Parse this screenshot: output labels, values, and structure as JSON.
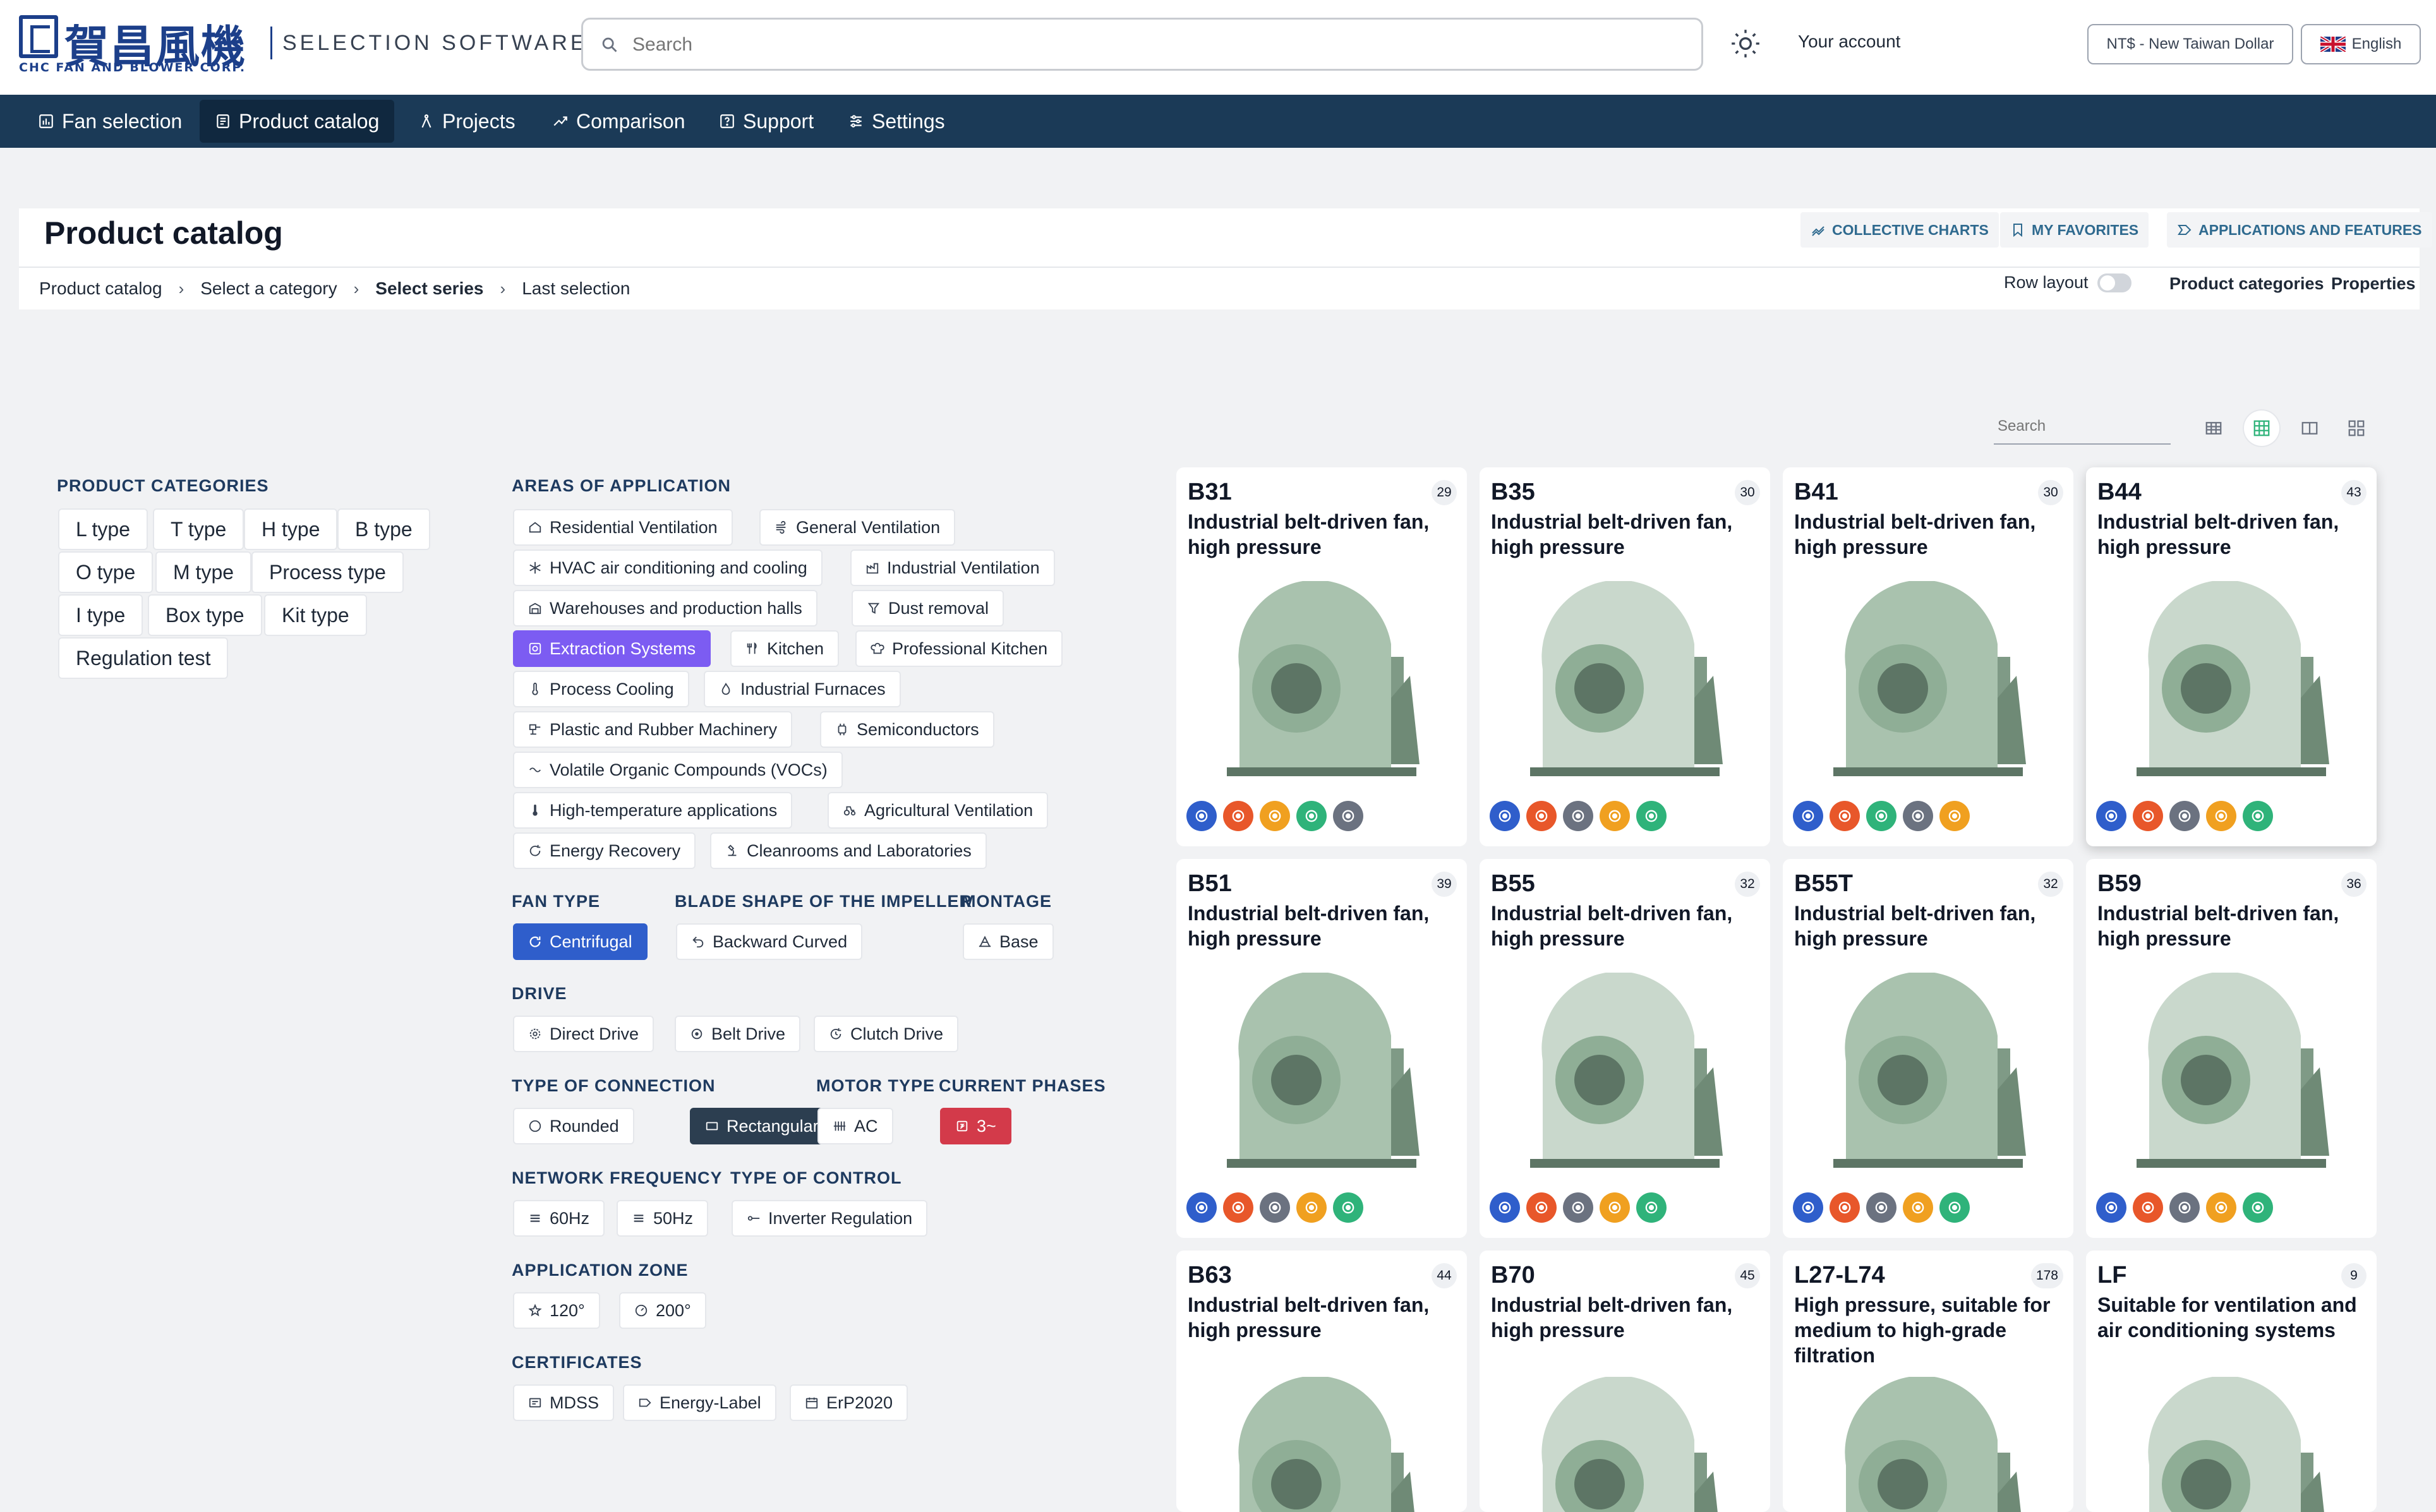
{
  "header": {
    "logo_cn": "賀昌風機",
    "logo_en": "CHC FAN AND BLOWER CORP.",
    "app_title": "SELECTION SOFTWARE",
    "search_placeholder": "Search",
    "account": "Your account",
    "currency": "NT$ - New Taiwan Dollar",
    "language": "English"
  },
  "nav": [
    {
      "label": "Fan selection",
      "icon": "chart-icon"
    },
    {
      "label": "Product catalog",
      "icon": "catalog-icon"
    },
    {
      "label": "Projects",
      "icon": "compass-icon"
    },
    {
      "label": "Comparison",
      "icon": "compare-icon"
    },
    {
      "label": "Support",
      "icon": "help-icon"
    },
    {
      "label": "Settings",
      "icon": "sliders-icon"
    }
  ],
  "page": {
    "title": "Product catalog",
    "actions": [
      "COLLECTIVE CHARTS",
      "MY FAVORITES",
      "APPLICATIONS AND FEATURES"
    ],
    "breadcrumb": [
      "Product catalog",
      "Select a category",
      "Select series",
      "Last selection"
    ],
    "row_layout": "Row layout",
    "links": [
      "Product categories",
      "Properties"
    ]
  },
  "filters": {
    "categories_title": "PRODUCT CATEGORIES",
    "categories": [
      "L type",
      "T type",
      "H type",
      "B type",
      "O type",
      "M type",
      "Process type",
      "I type",
      "Box type",
      "Kit type",
      "Regulation test"
    ],
    "areas_title": "AREAS OF APPLICATION",
    "areas": [
      "Residential Ventilation",
      "General Ventilation",
      "HVAC air conditioning and cooling",
      "Industrial Ventilation",
      "Warehouses and production halls",
      "Dust removal",
      "Extraction Systems",
      "Kitchen",
      "Professional Kitchen",
      "Process Cooling",
      "Industrial Furnaces",
      "Plastic and Rubber Machinery",
      "Semiconductors",
      "Volatile Organic Compounds (VOCs)",
      "High-temperature applications",
      "Agricultural Ventilation",
      "Energy Recovery",
      "Cleanrooms and Laboratories"
    ],
    "fan_type_title": "FAN TYPE",
    "fan_type": [
      "Centrifugal"
    ],
    "blade_title": "BLADE SHAPE OF THE IMPELLER",
    "blade": [
      "Backward Curved"
    ],
    "montage_title": "MONTAGE",
    "montage": [
      "Base"
    ],
    "drive_title": "DRIVE",
    "drive": [
      "Direct Drive",
      "Belt Drive",
      "Clutch Drive"
    ],
    "connection_title": "TYPE OF CONNECTION",
    "connection": [
      "Rounded",
      "Rectangular"
    ],
    "motor_title": "MOTOR TYPE",
    "motor": [
      "AC"
    ],
    "phases_title": "CURRENT PHASES",
    "phases": [
      "3~"
    ],
    "frequency_title": "NETWORK FREQUENCY",
    "frequency": [
      "60Hz",
      "50Hz"
    ],
    "control_title": "TYPE OF CONTROL",
    "control": [
      "Inverter Regulation"
    ],
    "zone_title": "APPLICATION ZONE",
    "zone": [
      "120°",
      "200°"
    ],
    "cert_title": "CERTIFICATES",
    "cert": [
      "MDSS",
      "Energy-Label",
      "ErP2020"
    ]
  },
  "catalog": {
    "search_placeholder": "Search",
    "view_modes": [
      "table-view-icon",
      "grid-view-icon",
      "columns-view-icon",
      "tiles-view-icon"
    ],
    "badge_colors": {
      "blue": "#2f5ecb",
      "orange": "#e8572a",
      "grey": "#6b7280",
      "yellow": "#f0a020",
      "green": "#2fb37a"
    },
    "cards": [
      {
        "code": "B31",
        "count": "29",
        "desc": "Industrial belt-driven fan, high pressure",
        "badges": [
          "blue",
          "orange",
          "yellow",
          "green",
          "grey"
        ]
      },
      {
        "code": "B35",
        "count": "30",
        "desc": "Industrial belt-driven fan, high pressure",
        "badges": [
          "blue",
          "orange",
          "grey",
          "yellow",
          "green"
        ]
      },
      {
        "code": "B41",
        "count": "30",
        "desc": "Industrial belt-driven fan, high pressure",
        "badges": [
          "blue",
          "orange",
          "green",
          "grey",
          "yellow"
        ]
      },
      {
        "code": "B44",
        "count": "43",
        "desc": "Industrial belt-driven fan, high pressure",
        "badges": [
          "blue",
          "orange",
          "grey",
          "yellow",
          "green"
        ]
      },
      {
        "code": "B51",
        "count": "39",
        "desc": "Industrial belt-driven fan, high pressure",
        "badges": [
          "blue",
          "orange",
          "grey",
          "yellow",
          "green"
        ]
      },
      {
        "code": "B55",
        "count": "32",
        "desc": "Industrial belt-driven fan, high pressure",
        "badges": [
          "blue",
          "orange",
          "grey",
          "yellow",
          "green"
        ]
      },
      {
        "code": "B55T",
        "count": "32",
        "desc": "Industrial belt-driven fan, high pressure",
        "badges": [
          "blue",
          "orange",
          "grey",
          "yellow",
          "green"
        ]
      },
      {
        "code": "B59",
        "count": "36",
        "desc": "Industrial belt-driven fan, high pressure",
        "badges": [
          "blue",
          "orange",
          "grey",
          "yellow",
          "green"
        ]
      },
      {
        "code": "B63",
        "count": "44",
        "desc": "Industrial belt-driven fan, high pressure",
        "badges": []
      },
      {
        "code": "B70",
        "count": "45",
        "desc": "Industrial belt-driven fan, high pressure",
        "badges": []
      },
      {
        "code": "L27-L74",
        "count": "178",
        "desc": "High pressure, suitable for medium to high-grade filtration",
        "badges": []
      },
      {
        "code": "LF",
        "count": "9",
        "desc": "Suitable for ventilation and air conditioning systems",
        "badges": []
      }
    ]
  }
}
